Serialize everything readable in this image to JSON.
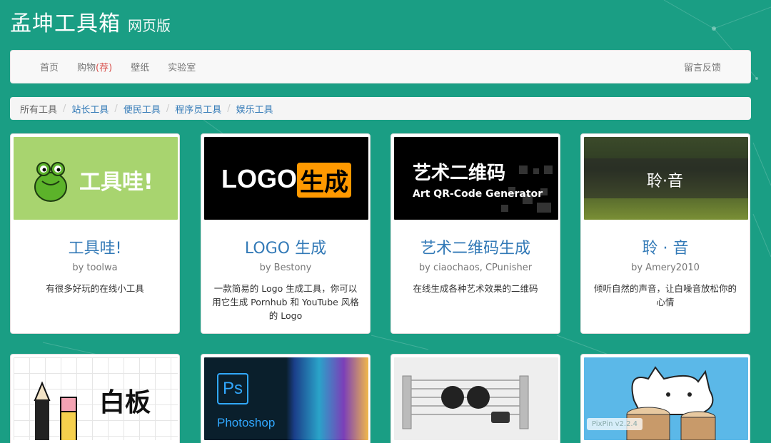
{
  "brand": {
    "title": "孟坤工具箱",
    "subtitle": "网页版"
  },
  "nav": {
    "items": [
      "首页",
      "购物",
      "壁纸",
      "实验室"
    ],
    "hot_tag": "(荐)",
    "feedback": "留言反馈"
  },
  "breadcrumbs": [
    "所有工具",
    "站长工具",
    "便民工具",
    "程序员工具",
    "娱乐工具"
  ],
  "cards": [
    {
      "name": "工具哇!",
      "by": "by toolwa",
      "desc": "有很多好玩的在线小工具",
      "thumb_text": "工具哇!"
    },
    {
      "name": "LOGO 生成",
      "by": "by Bestony",
      "desc": "一款简易的 Logo 生成工具，你可以用它生成 Pornhub 和 YouTube 风格的 Logo",
      "thumb_text_a": "LOGO",
      "thumb_text_b": "生成"
    },
    {
      "name": "艺术二维码生成",
      "by": "by ciaochaos, CPunisher",
      "desc": "在线生成各种艺术效果的二维码",
      "thumb_title": "艺术二维码",
      "thumb_sub": "Art QR-Code Generator"
    },
    {
      "name": "聆 · 音",
      "by": "by Amery2010",
      "desc": "倾听自然的声音，让白噪音放松你的心情",
      "thumb_text": "聆·音"
    }
  ],
  "cards2": [
    {
      "thumb_text": "白板"
    },
    {
      "thumb_text": "Photoshop",
      "thumb_logo": "Ps"
    },
    {
      "thumb_text": ""
    },
    {
      "thumb_text": ""
    }
  ],
  "watermark": "PixPin v2.2.4",
  "colors": {
    "background": "#1a9e84",
    "link": "#337ab7",
    "hot": "#d9534f"
  }
}
